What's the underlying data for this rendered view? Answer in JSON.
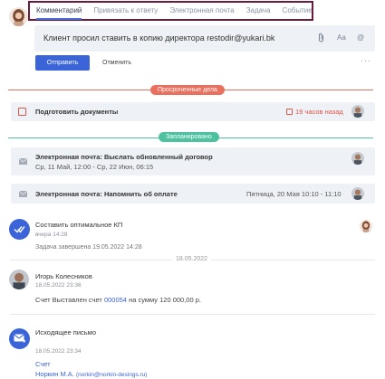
{
  "composer": {
    "tabs": [
      {
        "label": "Комментарий",
        "active": true
      },
      {
        "label": "Привязать к ответу",
        "active": false
      },
      {
        "label": "Электронная почта",
        "active": false
      },
      {
        "label": "Задача",
        "active": false
      },
      {
        "label": "Событие",
        "active": false
      }
    ],
    "text": "Клиент просил ставить в копию директора restodir@yukari.bk",
    "format_label": "Aa",
    "mention_label": "@",
    "send_label": "Отправить",
    "cancel_label": "Отменить",
    "more_label": "···"
  },
  "overdue": {
    "label": "Просроченные дела",
    "color": "#e8705f",
    "item": {
      "title": "Подготовить документы",
      "time": "19 часов назад"
    }
  },
  "planned": {
    "label": "Запланировано",
    "color": "#4ec2a0",
    "items": [
      {
        "title": "Электронная почта: Выслать обновленный договор",
        "subtitle": "Ср, 11 Май, 12:00 - Ср, 22 Июн, 06:15"
      },
      {
        "title": "Электронная почта: Напомнить об оплате",
        "time": "Пятница, 20 Мая 10:10 - 11:10"
      }
    ]
  },
  "history": {
    "task": {
      "title": "Составить оптимальное КП",
      "time": "вчера 14:28",
      "status": "Задача завершена 19.05.2022 14:28"
    },
    "date_separator": "18.05.2022",
    "comment": {
      "author": "Игорь Колесников",
      "time": "18.05.2022 23:36",
      "text_before": "Счет Выставлен счет ",
      "link": "000054",
      "text_after": " на сумму 120 000,00 р."
    },
    "email": {
      "title": "Исходящее письмо",
      "time": "18.05.2022 23:34",
      "subject": "Счет",
      "from_name": "Норкин М.А.",
      "from_email": "(norkin@norkin-desings.ru)"
    }
  },
  "colors": {
    "accent": "#3a64d8",
    "overdue": "#e8705f",
    "planned": "#4ec2a0",
    "tab_highlight_border": "#6b1b3b"
  }
}
